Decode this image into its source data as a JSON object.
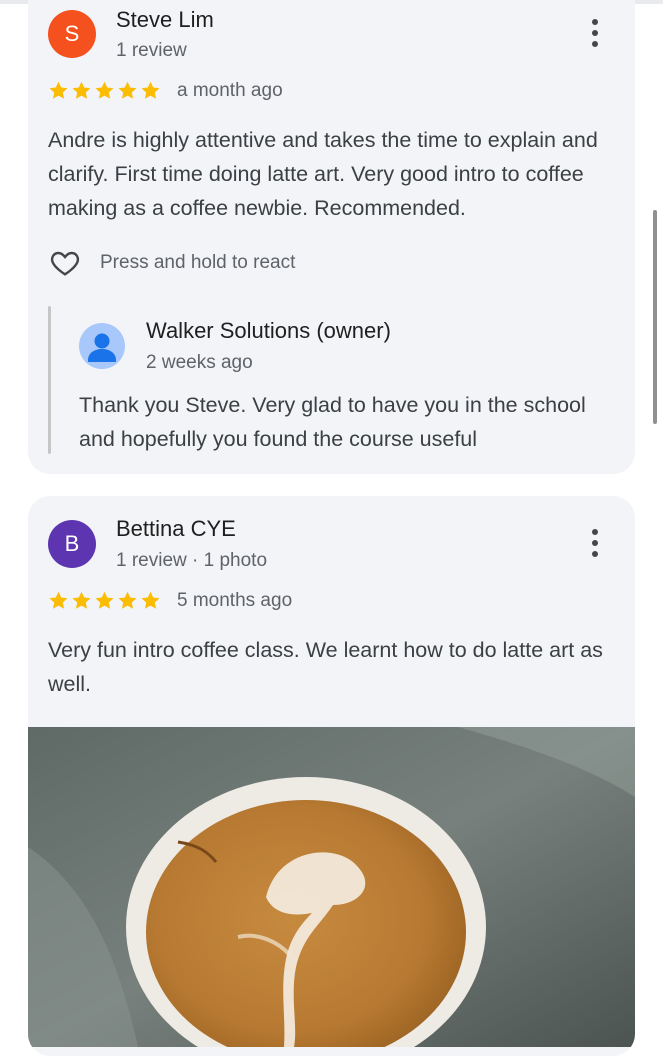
{
  "reviews": [
    {
      "initial": "S",
      "avatar_color": "#f4511e",
      "author": "Steve Lim",
      "meta": "1 review",
      "rating": 5,
      "date": "a month ago",
      "text": "Andre is highly attentive and takes the time to explain and clarify. First time doing latte art. Very good intro to coffee making as a coffee newbie. Recommended.",
      "react_label": "Press and hold to react",
      "owner_reply": {
        "name": "Walker Solutions (owner)",
        "date": "2 weeks ago",
        "text": "Thank you Steve. Very glad to have you in the school and hopefully you found the course useful"
      }
    },
    {
      "initial": "B",
      "avatar_color": "#5e35b1",
      "author": "Bettina CYE",
      "meta": "1 review · 1 photo",
      "rating": 5,
      "date": "5 months ago",
      "text": "Very fun intro coffee class. We learnt how to do latte art as well.",
      "photo_icon": "latte-art-photo"
    }
  ],
  "colors": {
    "star": "#fbbc04",
    "card_bg": "#f2f4f8"
  }
}
